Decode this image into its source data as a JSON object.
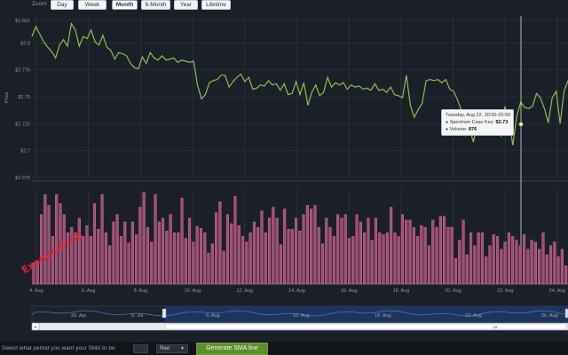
{
  "zoom": {
    "label": "Zoom",
    "buttons": [
      "Day",
      "Week",
      "Month",
      "6-Month",
      "Year",
      "Lifetime"
    ],
    "active": "Month"
  },
  "colors": {
    "background": "#1b2028",
    "grid": "#2c3340",
    "price_line": "#8fbc55",
    "volume_bar": "#a54d76",
    "volume_bar_edge": "#d27aa0",
    "navigator_fill": "#1f3b6e",
    "navigator_line": "#4f6fa8",
    "button_green": "#5e8f2e"
  },
  "price_axis": {
    "title": "Price",
    "ticks": [
      "$2.821",
      "$2.8",
      "$2.775",
      "$2.75",
      "$2.725",
      "$2.7",
      "$2.675"
    ]
  },
  "x_axis": {
    "ticks": [
      "4. Aug",
      "6. Aug",
      "8. Aug",
      "10. Aug",
      "12. Aug",
      "14. Aug",
      "16. Aug",
      "18. Aug",
      "20. Aug",
      "22. Aug",
      "24. Aug"
    ]
  },
  "tooltip": {
    "date": "Tuesday, Aug 22, 20:00-20:59",
    "price_label": "Spectrum Case Key:",
    "price_value": "$2.73",
    "volume_label": "Volume:",
    "volume_value": "876"
  },
  "navigator": {
    "labels": [
      "20. Apr",
      "6. Jul",
      "6. Aug",
      "10. Aug",
      "18. Aug",
      "22. Aug",
      "26. Aug"
    ],
    "scroll_left_mark": "+",
    "scroll_right_mark": "16"
  },
  "sma": {
    "label": "Select what period you want your SMA to be:",
    "period_value": "",
    "color_option": "Red",
    "button_label": "Generate SMA line"
  },
  "watermark": "Exodus-Exo8",
  "chart_data": {
    "type": "line",
    "title": "",
    "xlabel": "",
    "ylabel": "Price",
    "ylim": [
      2.675,
      2.825
    ],
    "x_range": [
      "4. Aug",
      "24. Aug"
    ],
    "price_series": {
      "name": "Spectrum Case Key",
      "values": [
        2.806,
        2.815,
        2.808,
        2.801,
        2.796,
        2.792,
        2.786,
        2.798,
        2.803,
        2.797,
        2.818,
        2.812,
        2.797,
        2.806,
        2.804,
        2.812,
        2.801,
        2.798,
        2.807,
        2.796,
        2.793,
        2.785,
        2.791,
        2.79,
        2.788,
        2.781,
        2.777,
        2.776,
        2.787,
        2.781,
        2.791,
        2.786,
        2.784,
        2.788,
        2.784,
        2.785,
        2.786,
        2.782,
        2.784,
        2.783,
        2.782,
        2.783,
        2.761,
        2.748,
        2.752,
        2.763,
        2.765,
        2.766,
        2.77,
        2.77,
        2.759,
        2.764,
        2.768,
        2.771,
        2.764,
        2.768,
        2.757,
        2.758,
        2.761,
        2.76,
        2.765,
        2.761,
        2.762,
        2.756,
        2.762,
        2.752,
        2.753,
        2.764,
        2.752,
        2.763,
        2.742,
        2.754,
        2.761,
        2.751,
        2.754,
        2.768,
        2.759,
        2.763,
        2.761,
        2.763,
        2.757,
        2.761,
        2.759,
        2.76,
        2.757,
        2.758,
        2.756,
        2.762,
        2.756,
        2.757,
        2.754,
        2.759,
        2.752,
        2.751,
        2.749,
        2.77,
        2.742,
        2.731,
        2.738,
        2.744,
        2.765,
        2.766,
        2.765,
        2.766,
        2.763,
        2.766,
        2.757,
        2.755,
        2.747,
        2.737,
        2.714,
        2.72,
        2.708,
        2.726,
        2.731,
        2.727,
        2.732,
        2.722,
        2.728,
        2.713,
        2.741,
        2.729,
        2.705,
        2.732,
        2.745,
        2.74,
        2.739,
        2.741,
        2.753,
        2.749,
        2.739,
        2.726,
        2.749,
        2.755,
        2.725,
        2.755,
        2.765
      ]
    },
    "volume_series": {
      "name": "Volume",
      "values": [
        230,
        240,
        760,
        980,
        860,
        520,
        980,
        880,
        760,
        560,
        620,
        560,
        720,
        520,
        640,
        520,
        880,
        600,
        980,
        560,
        420,
        680,
        760,
        520,
        680,
        450,
        680,
        540,
        840,
        1000,
        620,
        460,
        980,
        680,
        720,
        580,
        760,
        560,
        560,
        940,
        500,
        720,
        460,
        630,
        610,
        560,
        340,
        440,
        780,
        900,
        360,
        760,
        660,
        960,
        640,
        520,
        460,
        560,
        680,
        620,
        800,
        560,
        720,
        840,
        720,
        430,
        820,
        600,
        600,
        720,
        580,
        760,
        860,
        820,
        860,
        620,
        440,
        720,
        620,
        520,
        760,
        720,
        760,
        500,
        520,
        760,
        680,
        560,
        720,
        480,
        720,
        560,
        540,
        560,
        840,
        560,
        520,
        760,
        700,
        700,
        620,
        520,
        640,
        620,
        420,
        700,
        620,
        740,
        740,
        620,
        620,
        280,
        480,
        700,
        320,
        560,
        420,
        560,
        560,
        300,
        420,
        540,
        520,
        380,
        460,
        560,
        520,
        480,
        420,
        540,
        380,
        480,
        460,
        380,
        560,
        320,
        420,
        460,
        300,
        380,
        200
      ]
    }
  }
}
